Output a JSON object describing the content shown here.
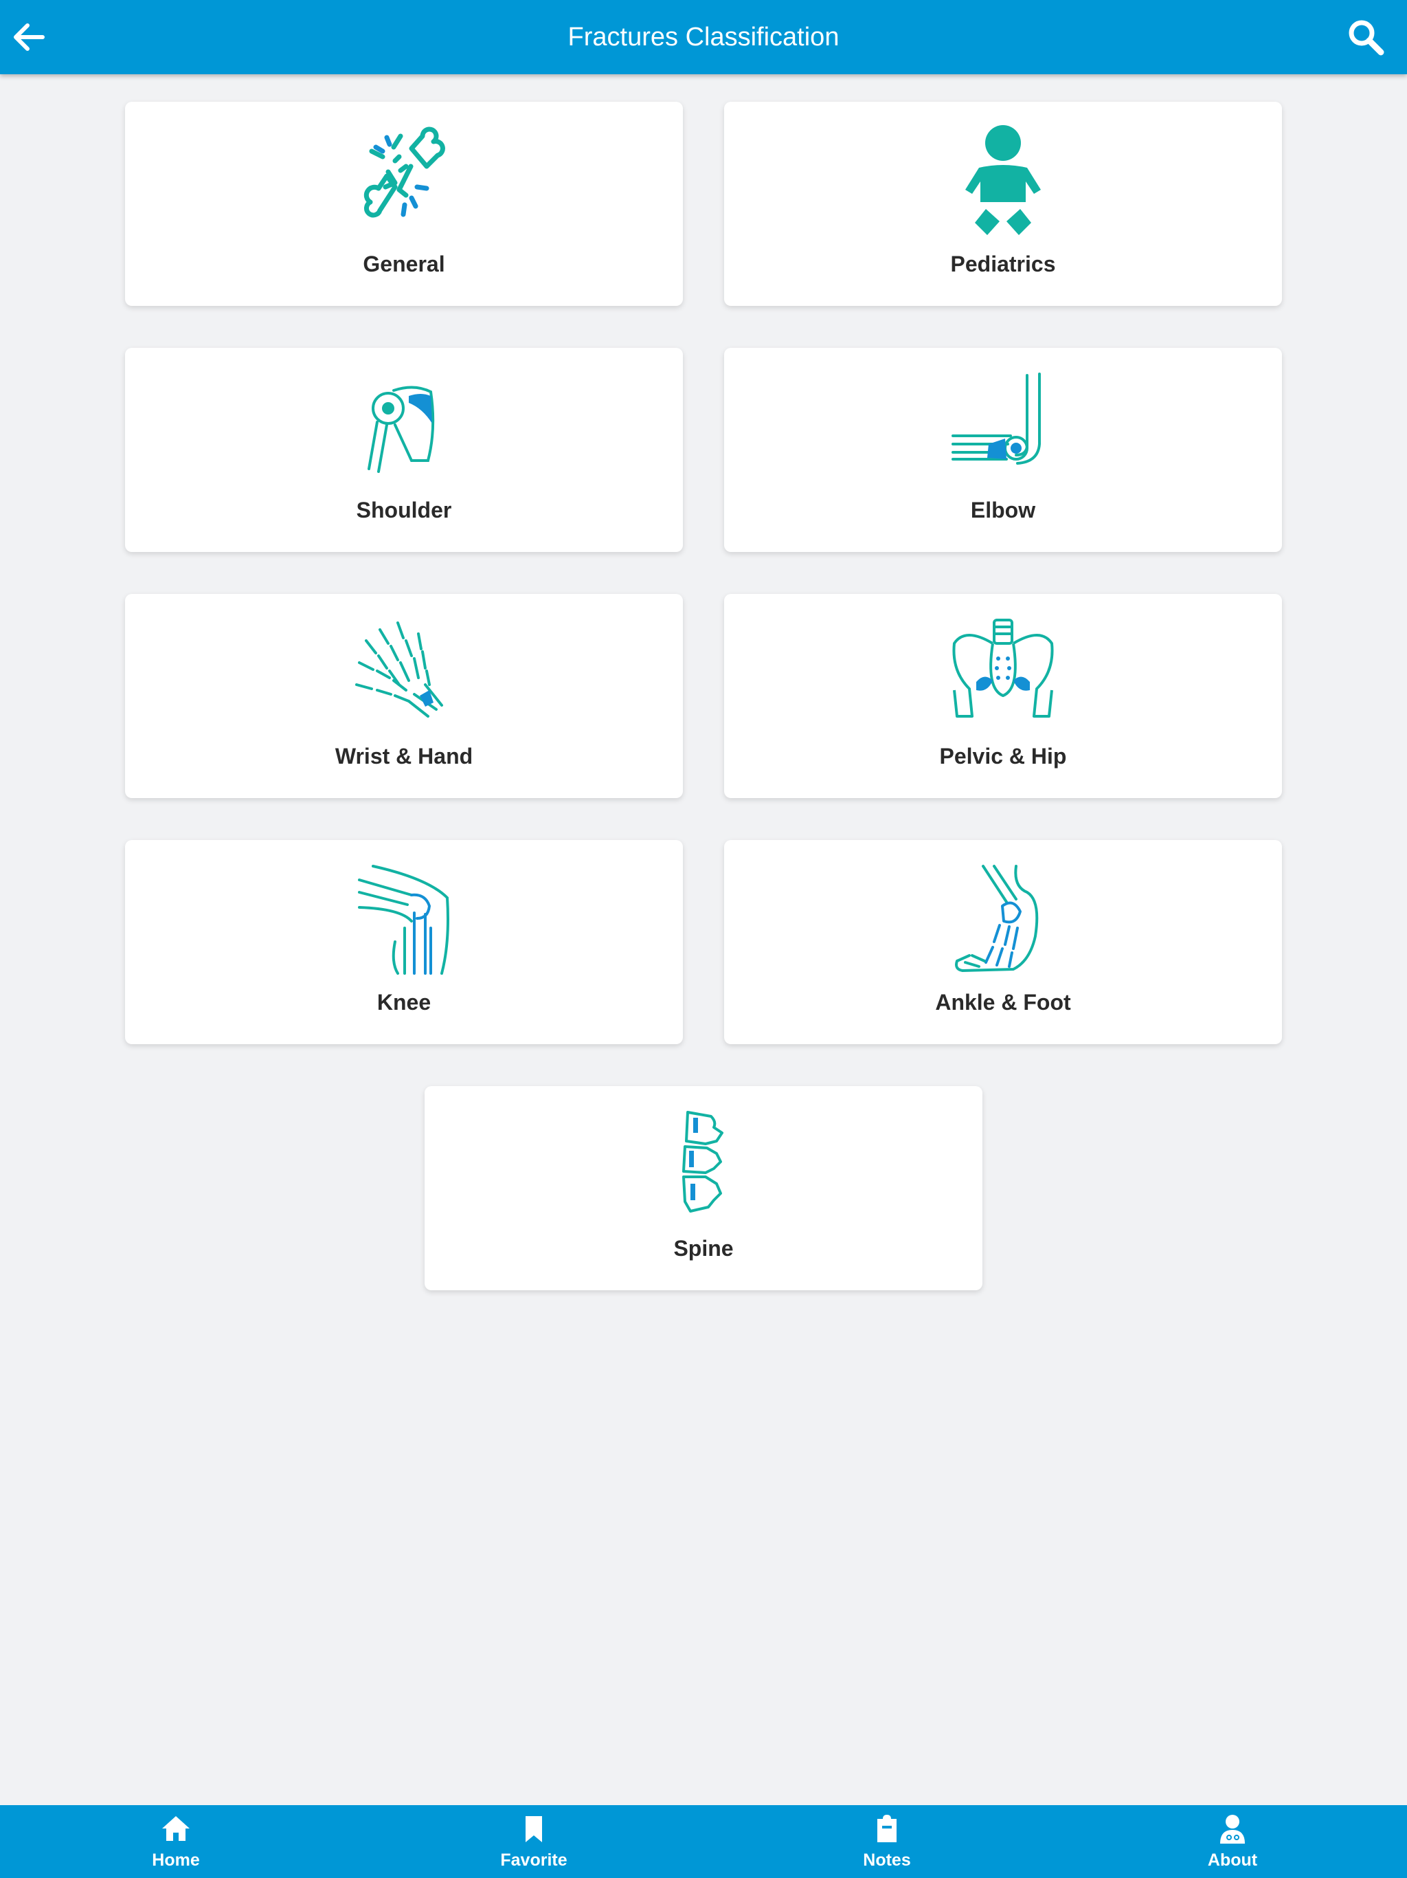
{
  "header": {
    "title": "Fractures Classification",
    "back_icon": "arrow-left-icon",
    "search_icon": "search-icon"
  },
  "categories": [
    {
      "label": "General",
      "icon": "broken-bone-icon"
    },
    {
      "label": "Pediatrics",
      "icon": "baby-icon"
    },
    {
      "label": "Shoulder",
      "icon": "shoulder-joint-icon"
    },
    {
      "label": "Elbow",
      "icon": "elbow-joint-icon"
    },
    {
      "label": "Wrist & Hand",
      "icon": "hand-bones-icon"
    },
    {
      "label": "Pelvic & Hip",
      "icon": "pelvis-icon"
    },
    {
      "label": "Knee",
      "icon": "knee-joint-icon"
    },
    {
      "label": "Ankle & Foot",
      "icon": "foot-bones-icon"
    },
    {
      "label": "Spine",
      "icon": "spine-icon"
    }
  ],
  "bottom_nav": [
    {
      "label": "Home",
      "icon": "home-icon"
    },
    {
      "label": "Favorite",
      "icon": "bookmark-icon"
    },
    {
      "label": "Notes",
      "icon": "clipboard-icon"
    },
    {
      "label": "About",
      "icon": "doctor-icon"
    }
  ],
  "colors": {
    "primary": "#0097d6",
    "icon_teal": "#12b2a3",
    "icon_blue": "#1490d4",
    "background": "#f1f2f4",
    "card": "#ffffff",
    "label_text": "#2a2a2a"
  }
}
